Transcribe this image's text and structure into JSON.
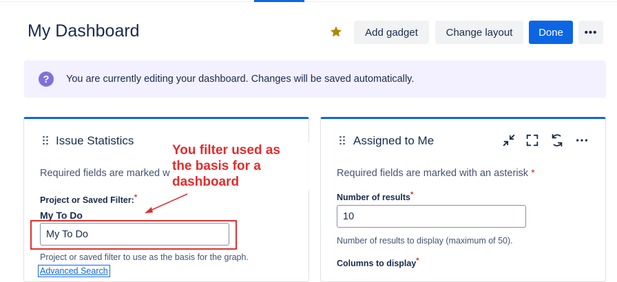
{
  "page": {
    "title": "My Dashboard"
  },
  "toolbar": {
    "star_icon": "star-icon",
    "add_gadget_label": "Add gadget",
    "change_layout_label": "Change layout",
    "done_label": "Done",
    "more_label": "•••"
  },
  "banner": {
    "icon": "help-icon",
    "icon_glyph": "?",
    "text": "You are currently editing your dashboard. Changes will be saved automatically."
  },
  "gadgets": {
    "issue_statistics": {
      "title": "Issue Statistics",
      "required_text": "Required fields are marked w",
      "project_filter_label": "Project or Saved Filter:",
      "asterisk": "*",
      "selected_filter_name": "My To Do",
      "filter_input_value": "My To Do",
      "filter_help_text": "Project or saved filter to use as the basis for the graph.",
      "advanced_search_link": "Advanced Search"
    },
    "assigned_to_me": {
      "title": "Assigned to Me",
      "required_text": "Required fields are marked with an asterisk",
      "asterisk": "*",
      "number_of_results_label": "Number of results",
      "number_of_results_value": "10",
      "number_of_results_help": "Number of results to display (maximum of 50).",
      "columns_label": "Columns to display",
      "icons": [
        "minimize-icon",
        "fullscreen-icon",
        "refresh-icon",
        "more-icon"
      ]
    }
  },
  "annotation": {
    "text_line1": "You filter used as",
    "text_line2": "the basis for a",
    "text_line3": "dashboard"
  },
  "colors": {
    "primary": "#0c66e4",
    "banner_bg": "#f3f0ff",
    "banner_icon": "#8270db",
    "annotation_red": "#e52b2b",
    "star": "#b38600"
  }
}
